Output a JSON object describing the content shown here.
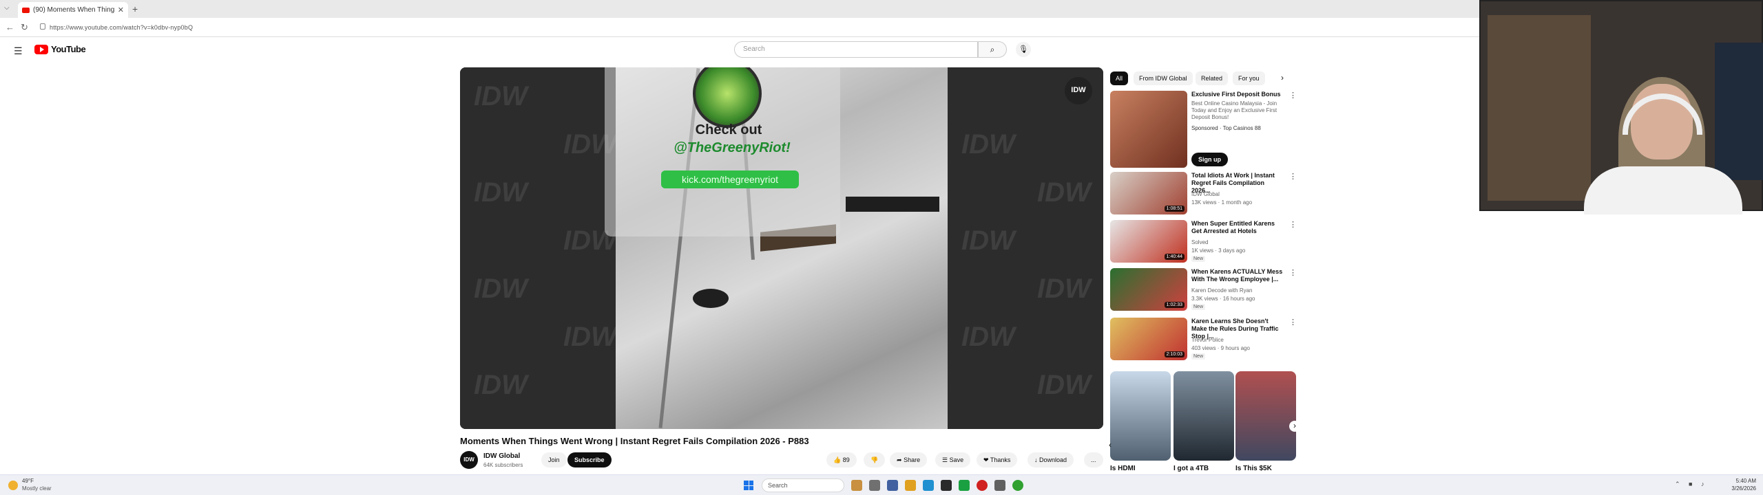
{
  "browser": {
    "tab_title": "(90) Moments When Things",
    "new_tab": "+",
    "url": "https://www.youtube.com/watch?v=k0dbv-nyp0bQ"
  },
  "youtube": {
    "logo": "YouTube",
    "search_placeholder": "Search"
  },
  "video": {
    "promo_line1": "Check out",
    "promo_line2": "@TheGreenyRiot!",
    "promo_link": "kick.com/thegreenyriot",
    "watermark": "IDW",
    "title": "Moments When Things Went Wrong | Instant Regret Fails Compilation 2026 - P883",
    "channel_name": "IDW Global",
    "channel_subs": "64K subscribers",
    "channel_mark": "IDW",
    "join_label": "Join",
    "subscribe_label": "Subscribe",
    "likes": "89",
    "share_label": "Share",
    "save_label": "Save",
    "thanks_label": "Thanks",
    "download_label": "Download",
    "more_label": "..."
  },
  "filter_chips": [
    "All",
    "From IDW Global",
    "Related",
    "For you"
  ],
  "recommendations": [
    {
      "title": "Exclusive First Deposit Bonus",
      "meta": "Best Online Casino Malaysia - Join Today and Enjoy an Exclusive First Deposit Bonus!",
      "sponsored": "Sponsored · Top Casinos 88",
      "cta": "Sign up",
      "duration": ""
    },
    {
      "title": "Total Idiots At Work | Instant Regret Fails Compilation 2026...",
      "meta": "IDW Global",
      "sub": "13K views · 1 month ago",
      "duration": "1:08:51"
    },
    {
      "title": "When Super Entitled Karens Get Arrested at Hotels",
      "meta": "Solved",
      "sub": "1K views · 3 days ago",
      "badge": "New",
      "duration": "1:40:44"
    },
    {
      "title": "When Karens ACTUALLY Mess With The Wrong Employee |...",
      "meta": "Karen Decode with Ryan",
      "sub": "3.3K views · 16 hours ago",
      "badge": "New",
      "duration": "1:02:33"
    },
    {
      "title": "Karen Learns She Doesn't Make the Rules During Traffic Stop |...",
      "meta": "Trevor Police",
      "sub": "403 views · 9 hours ago",
      "badge": "New",
      "duration": "2:10:03"
    }
  ],
  "shorts": [
    {
      "title": "Is HDMI"
    },
    {
      "title": "I got a 4TB"
    },
    {
      "title": "Is This $5K"
    }
  ],
  "taskbar": {
    "weather_temp": "49°F",
    "weather_desc": "Mostly clear",
    "search_label": "Search",
    "time": "5:40 AM",
    "date": "3/26/2026"
  }
}
